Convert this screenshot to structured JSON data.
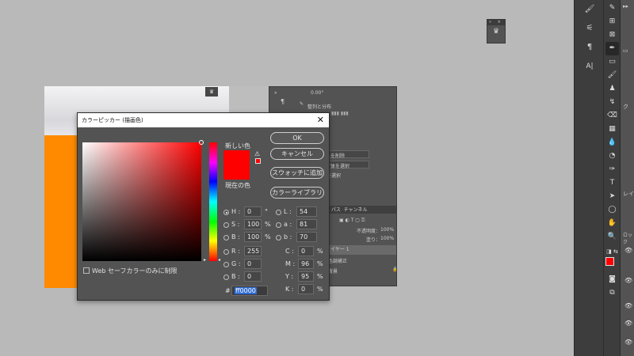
{
  "mini_panel": {
    "icon": "crown-icon"
  },
  "document": {
    "tab_icon": "crown-icon"
  },
  "properties": {
    "value_1": "0.00°",
    "header": "整列と分布",
    "btn_a": "背景を削除",
    "btn_b": "被写体を選択",
    "btn_c": "色域を選択",
    "layers_tabs": [
      "ヤー",
      "パス",
      "チャンネル"
    ],
    "opacity_label": "不透明度：",
    "opacity_value": "100%",
    "fill_label": "塗り：",
    "fill_value": "100%",
    "layer_1": "イヤー 1",
    "layer_2": "色調補正",
    "layer_3": "背景"
  },
  "dialog": {
    "title": "カラーピッカー (描画色)",
    "new_label": "新しい色",
    "current_label": "現在の色",
    "ok": "OK",
    "cancel": "キャンセル",
    "add_swatch": "スウォッチに追加",
    "color_library": "カラーライブラリ",
    "hsb": [
      {
        "label": "H :",
        "value": "0",
        "unit": "°"
      },
      {
        "label": "S :",
        "value": "100",
        "unit": "%"
      },
      {
        "label": "B :",
        "value": "100",
        "unit": "%"
      }
    ],
    "rgb": [
      {
        "label": "R :",
        "value": "255"
      },
      {
        "label": "G :",
        "value": "0"
      },
      {
        "label": "B :",
        "value": "0"
      }
    ],
    "lab": [
      {
        "label": "L :",
        "value": "54"
      },
      {
        "label": "a :",
        "value": "81"
      },
      {
        "label": "b :",
        "value": "70"
      }
    ],
    "cmyk": [
      {
        "label": "C :",
        "value": "0",
        "unit": "%"
      },
      {
        "label": "M :",
        "value": "96",
        "unit": "%"
      },
      {
        "label": "Y :",
        "value": "95",
        "unit": "%"
      },
      {
        "label": "K :",
        "value": "0",
        "unit": "%"
      }
    ],
    "hex_label": "#",
    "hex_value": "ff0000",
    "web_only": "Web セーフカラーのみに制限",
    "selected_color": "#ff0000"
  },
  "right_panel": {
    "layers_label": "レイ",
    "lock_label": "ロック",
    "tab_k": "ク"
  }
}
